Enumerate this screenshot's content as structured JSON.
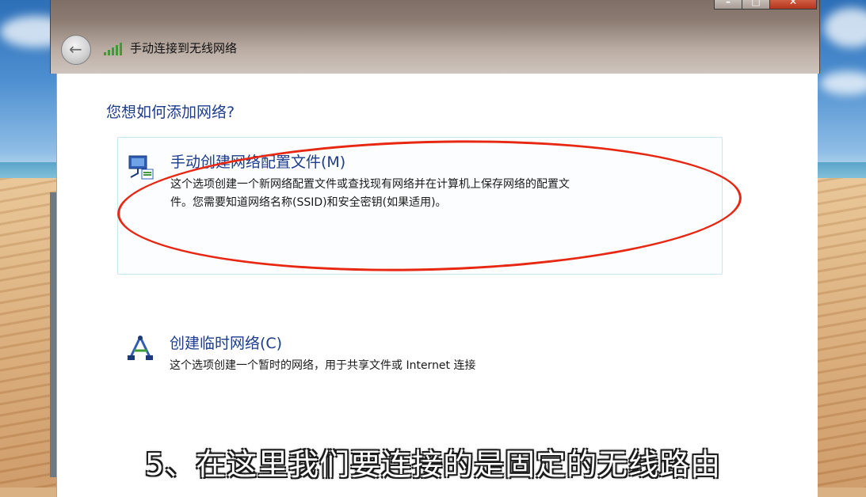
{
  "window": {
    "title": "手动连接到无线网络",
    "controls": {
      "minimize": "–",
      "maximize": "□",
      "close": "✕"
    },
    "icons": {
      "back": "back-arrow-icon",
      "title": "wireless-signal-icon"
    }
  },
  "page": {
    "heading": "您想如何添加网络?",
    "options": [
      {
        "title": "手动创建网络配置文件(M)",
        "desc_line1": "这个选项创建一个新网络配置文件或查找现有网络并在计算机上保存网络的配置文",
        "desc_line2": "件。您需要知道网络名称(SSID)和安全密钥(如果适用)。",
        "icon": "network-profile-icon"
      },
      {
        "title": "创建临时网络(C)",
        "desc_line1": "这个选项创建一个暂时的网络，用于共享文件或 Internet 连接",
        "icon": "adhoc-network-icon"
      }
    ]
  },
  "subtitle": "5、在这里我们要连接的是固定的无线路由",
  "colors": {
    "link_blue": "#1d3c8a",
    "annotation_red": "#e82712",
    "option_border": "#c8e6f3"
  }
}
